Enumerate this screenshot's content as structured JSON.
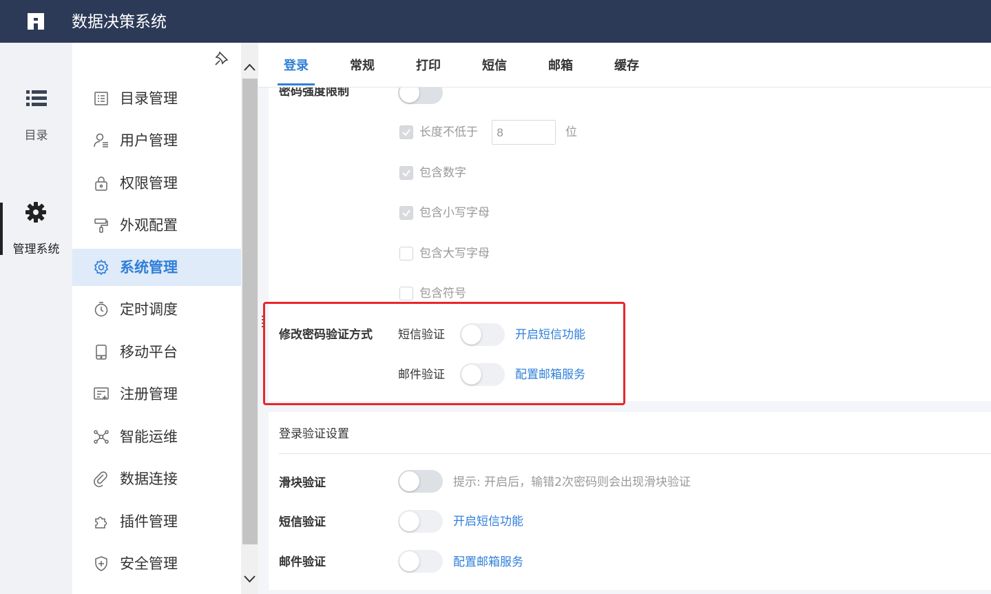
{
  "header": {
    "title": "数据决策系统",
    "logo_icon": "fine-logo"
  },
  "rail": [
    {
      "label": "目录",
      "icon": "list-icon",
      "active": false
    },
    {
      "label": "管理系统",
      "icon": "gear-icon",
      "active": true
    }
  ],
  "sidebar": {
    "items": [
      {
        "label": "目录管理",
        "icon": "catalog-icon"
      },
      {
        "label": "用户管理",
        "icon": "user-icon"
      },
      {
        "label": "权限管理",
        "icon": "lock-icon"
      },
      {
        "label": "外观配置",
        "icon": "paint-roller-icon"
      },
      {
        "label": "系统管理",
        "icon": "settings-icon",
        "active": true
      },
      {
        "label": "定时调度",
        "icon": "timer-icon"
      },
      {
        "label": "移动平台",
        "icon": "mobile-icon"
      },
      {
        "label": "注册管理",
        "icon": "register-icon"
      },
      {
        "label": "智能运维",
        "icon": "ops-icon"
      },
      {
        "label": "数据连接",
        "icon": "link-icon"
      },
      {
        "label": "插件管理",
        "icon": "plugin-icon"
      },
      {
        "label": "安全管理",
        "icon": "shield-icon"
      }
    ]
  },
  "tabs": [
    {
      "label": "登录",
      "active": true
    },
    {
      "label": "常规"
    },
    {
      "label": "打印"
    },
    {
      "label": "短信"
    },
    {
      "label": "邮箱"
    },
    {
      "label": "缓存"
    }
  ],
  "password": {
    "strength_label": "密码强度限制",
    "min_length_label": "长度不低于",
    "min_length_value": "8",
    "min_length_unit": "位",
    "rules": [
      {
        "label": "包含数字",
        "checked": true
      },
      {
        "label": "包含小写字母",
        "checked": true
      },
      {
        "label": "包含大写字母",
        "checked": false
      },
      {
        "label": "包含符号",
        "checked": false
      }
    ],
    "verify_label": "修改密码验证方式",
    "verify_sms_label": "短信验证",
    "verify_sms_link": "开启短信功能",
    "verify_mail_label": "邮件验证",
    "verify_mail_link": "配置邮箱服务"
  },
  "login_verify": {
    "title": "登录验证设置",
    "slider_label": "滑块验证",
    "slider_hint": "提示: 开启后，输错2次密码则会出现滑块验证",
    "sms_label": "短信验证",
    "sms_link": "开启短信功能",
    "mail_label": "邮件验证",
    "mail_link": "配置邮箱服务"
  },
  "colors": {
    "header_bg": "#2c3a57",
    "accent": "#2f7fd8",
    "highlight": "#e8262a"
  }
}
